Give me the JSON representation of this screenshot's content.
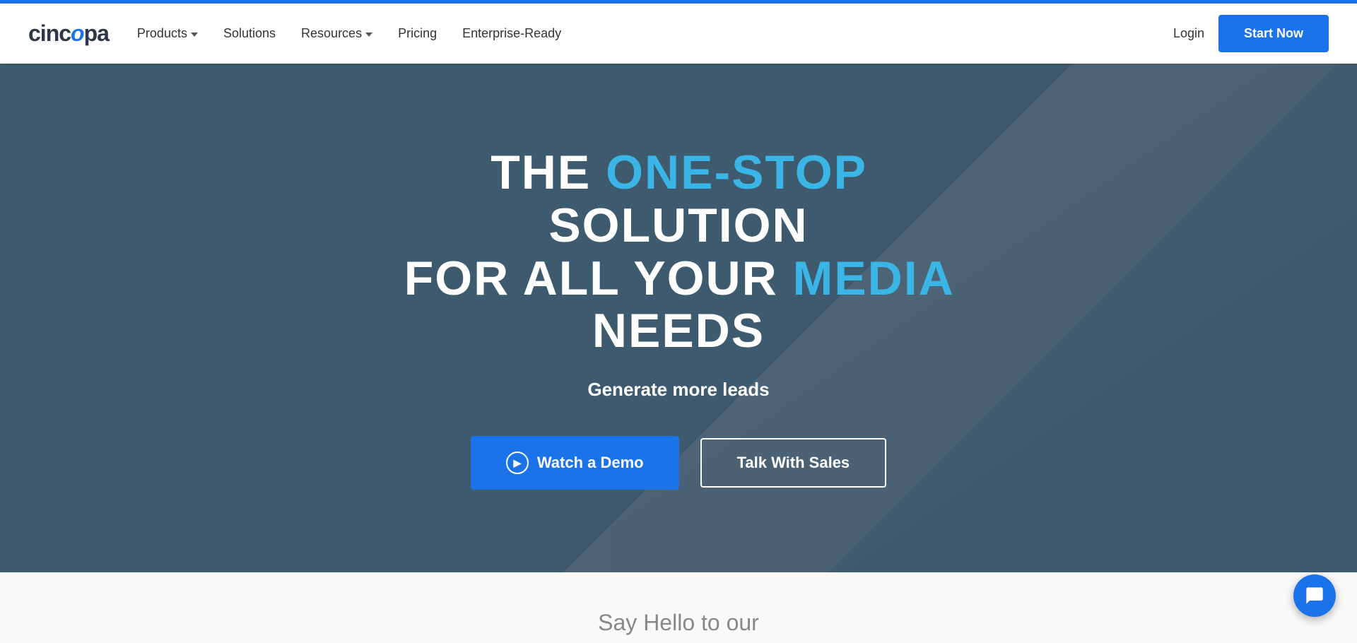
{
  "topbar": {},
  "nav": {
    "logo": {
      "text_before": "cinc",
      "logo_letter": "o",
      "text_after": "pa"
    },
    "links": [
      {
        "label": "Products",
        "has_dropdown": true
      },
      {
        "label": "Solutions",
        "has_dropdown": false
      },
      {
        "label": "Resources",
        "has_dropdown": true
      },
      {
        "label": "Pricing",
        "has_dropdown": false
      },
      {
        "label": "Enterprise-Ready",
        "has_dropdown": false
      }
    ],
    "login_label": "Login",
    "start_btn_label": "Start Now"
  },
  "hero": {
    "heading_part1": "THE ",
    "heading_highlight1": "ONE-STOP",
    "heading_part2": " SOLUTION",
    "heading_line2_part1": "FOR ALL YOUR ",
    "heading_highlight2": "MEDIA",
    "heading_line2_part2": " NEEDS",
    "subheading": "Generate more leads",
    "watch_demo_label": "Watch a Demo",
    "talk_sales_label": "Talk With Sales"
  },
  "below_fold": {
    "text": "Say Hello to our"
  },
  "chat": {
    "aria_label": "chat-button"
  }
}
